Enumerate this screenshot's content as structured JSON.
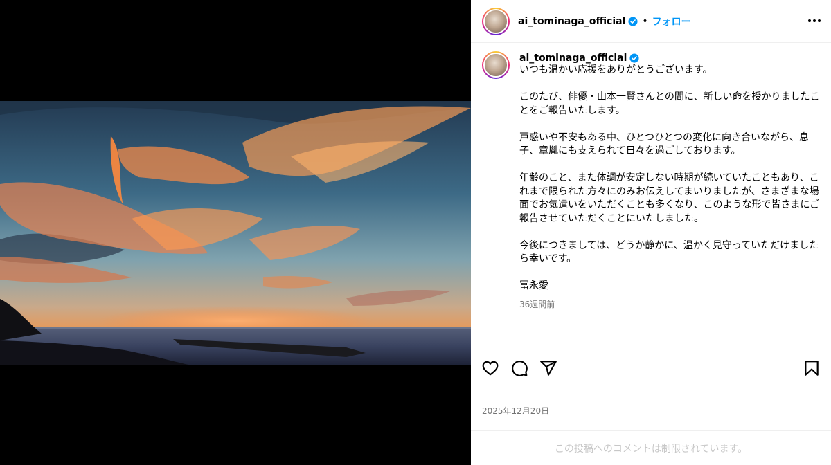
{
  "header": {
    "username": "ai_tominaga_official",
    "separator": "•",
    "follow_label": "フォロー"
  },
  "caption": {
    "username": "ai_tominaga_official",
    "paragraphs": [
      "いつも温かい応援をありがとうございます。",
      "このたび、俳優・山本一賢さんとの間に、新しい命を授かりましたことをご報告いたします。",
      "戸惑いや不安もある中、ひとつひとつの変化に向き合いながら、息子、章胤にも支えられて日々を過ごしております。",
      "年齢のこと、また体調が安定しない時期が続いていたこともあり、これまで限られた方々にのみお伝えしてまいりましたが、さまざまな場面でお気遣いをいただくことも多くなり、このような形で皆さまにご報告させていただくことにいたしました。",
      "今後につきましては、どうか静かに、温かく見守っていただけましたら幸いです。",
      "冨永愛"
    ],
    "time_ago": "36週間前"
  },
  "post": {
    "date": "2025年12月20日",
    "comments_notice": "この投稿へのコメントは制限されています。"
  },
  "icons": {
    "like": "heart-icon",
    "comment": "comment-icon",
    "share": "share-icon",
    "save": "bookmark-icon",
    "more": "more-icon",
    "verified": "verified-badge-icon"
  },
  "colors": {
    "link_blue": "#0095f6",
    "verified_blue": "#0095f6",
    "muted_text": "#737373",
    "disabled_text": "#c7c7c7"
  }
}
